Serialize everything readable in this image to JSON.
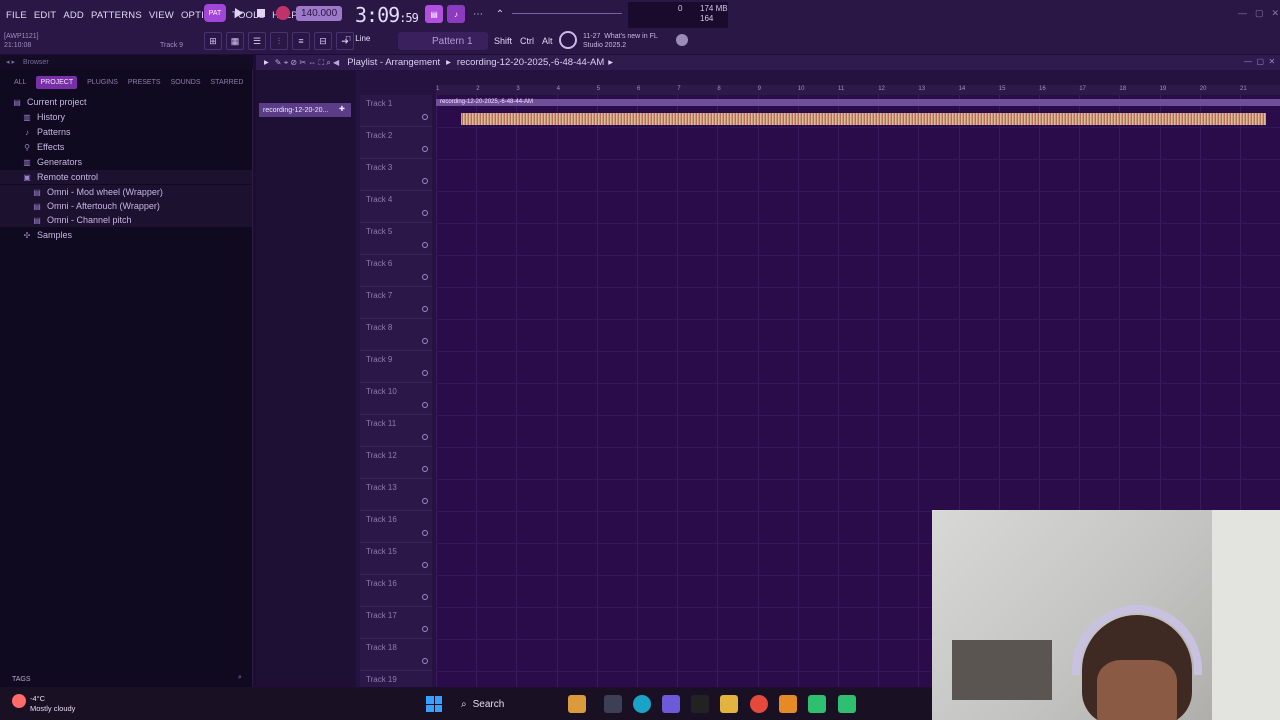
{
  "menu": [
    "FILE",
    "EDIT",
    "ADD",
    "PATTERNS",
    "VIEW",
    "OPTIONS",
    "TOOLS",
    "HELP"
  ],
  "transport": {
    "pattern_badge": "PAT",
    "tempo": "140.000"
  },
  "clock": {
    "main": "3:09",
    "sub": "59"
  },
  "cpu": {
    "left_value": "0",
    "mem": "174 MB",
    "voices": "164"
  },
  "hint": {
    "line1": "[AWP1121]",
    "line2": "21:10:08"
  },
  "track_hint": "Track 9",
  "snap": "Line",
  "pattern_selector": "Pattern 1",
  "keys": [
    "Shift",
    "Ctrl",
    "Alt"
  ],
  "news": {
    "date": "11-27",
    "title": "What's new in FL",
    "subtitle": "Studio 2025.2"
  },
  "browser": {
    "title": "Browser",
    "tabs": [
      "ALL",
      "PROJECT",
      "PLUGINS",
      "PRESETS",
      "SOUNDS",
      "STARRED"
    ],
    "active_tab": "PROJECT",
    "tree": [
      {
        "label": "Current project",
        "icon": "folder-icon",
        "indent": 0
      },
      {
        "label": "History",
        "icon": "history-icon",
        "indent": 1
      },
      {
        "label": "Patterns",
        "icon": "patterns-icon",
        "indent": 1
      },
      {
        "label": "Effects",
        "icon": "effects-icon",
        "indent": 1
      },
      {
        "label": "Generators",
        "icon": "generators-icon",
        "indent": 1
      },
      {
        "label": "Remote control",
        "icon": "remote-icon",
        "indent": 1
      },
      {
        "label": "Omni - Mod wheel (Wrapper)",
        "icon": "param-icon",
        "indent": 2
      },
      {
        "label": "Omni - Aftertouch (Wrapper)",
        "icon": "param-icon",
        "indent": 2
      },
      {
        "label": "Omni - Channel pitch",
        "icon": "param-icon",
        "indent": 2
      },
      {
        "label": "Samples",
        "icon": "samples-icon",
        "indent": 1
      }
    ],
    "tags_label": "TAGS"
  },
  "playlist": {
    "title": "Playlist - Arrangement",
    "breadcrumb": "recording-12-20-2025,-6-48-44-AM",
    "clip_list_item": "recording-12-20-20...",
    "clip_name": "recording-12-20-2025,-6-48-44-AM",
    "ruler": [
      "1",
      "2",
      "3",
      "4",
      "5",
      "6",
      "7",
      "8",
      "9",
      "10",
      "11",
      "12",
      "13",
      "14",
      "15",
      "16",
      "17",
      "18",
      "19",
      "20",
      "21"
    ],
    "tracks": [
      "Track 1",
      "Track 2",
      "Track 3",
      "Track 4",
      "Track 5",
      "Track 6",
      "Track 7",
      "Track 8",
      "Track 9",
      "Track 10",
      "Track 11",
      "Track 12",
      "Track 13",
      "Track 16",
      "Track 15",
      "Track 16",
      "Track 17",
      "Track 18",
      "Track 19"
    ]
  },
  "weather": {
    "temp": "-4°C",
    "desc": "Mostly cloudy"
  },
  "taskbar": {
    "search_label": "Search"
  }
}
